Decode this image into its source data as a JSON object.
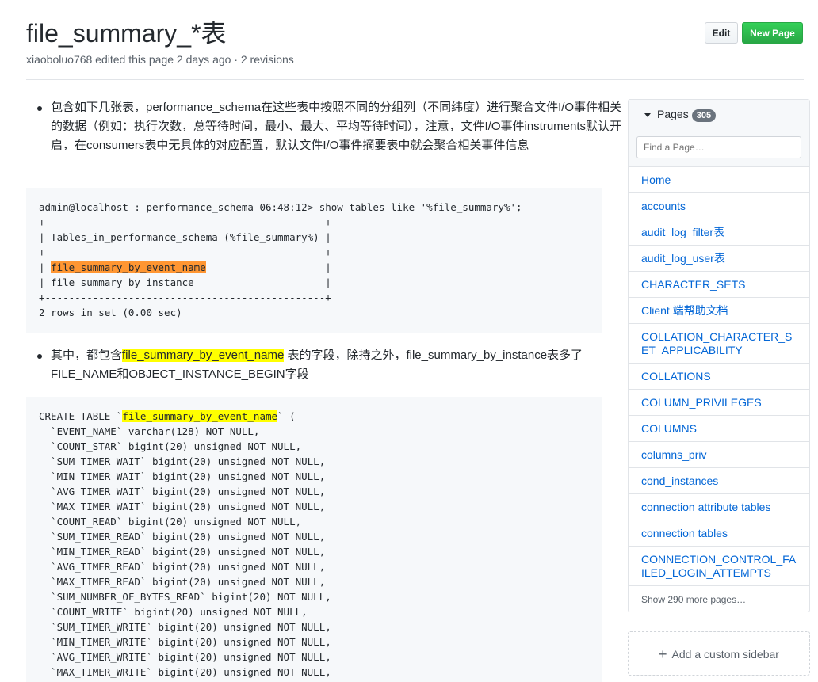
{
  "page": {
    "title": "file_summary_*表",
    "meta": "xiaoboluo768 edited this page 2 days ago · 2 revisions"
  },
  "actions": {
    "edit": "Edit",
    "new_page": "New Page"
  },
  "content": {
    "bullet1": "包含如下几张表，performance_schema在这些表中按照不同的分组列（不同纬度）进行聚合文件I/O事件相关的数据（例如：执行次数，总等待时间，最小、最大、平均等待时间），注意，文件I/O事件instruments默认开启，在consumers表中无具体的对应配置，默认文件I/O事件摘要表中就会聚合相关事件信息",
    "code1": {
      "l1": "admin@localhost : performance_schema 06:48:12> show tables like '%file_summary%';",
      "l2": "+-----------------------------------------------+",
      "l3": "| Tables_in_performance_schema (%file_summary%) |",
      "l4": "+-----------------------------------------------+",
      "l5_pre": "| ",
      "l5_hl": "file_summary_by_event_name",
      "l5_post": "                    |",
      "l6": "| file_summary_by_instance                      |",
      "l7": "+-----------------------------------------------+",
      "l8": "2 rows in set (0.00 sec)"
    },
    "bullet2": {
      "pre": "其中，都包含",
      "hl": "file_summary_by_event_name",
      "post": " 表的字段，除持之外，file_summary_by_instance表多了FILE_NAME和OBJECT_INSTANCE_BEGIN字段"
    },
    "code2": {
      "first_pre": "CREATE TABLE `",
      "first_hl": "file_summary_by_event_name",
      "first_post": "` (",
      "lines": [
        "  `EVENT_NAME` varchar(128) NOT NULL,",
        "  `COUNT_STAR` bigint(20) unsigned NOT NULL,",
        "  `SUM_TIMER_WAIT` bigint(20) unsigned NOT NULL,",
        "  `MIN_TIMER_WAIT` bigint(20) unsigned NOT NULL,",
        "  `AVG_TIMER_WAIT` bigint(20) unsigned NOT NULL,",
        "  `MAX_TIMER_WAIT` bigint(20) unsigned NOT NULL,",
        "  `COUNT_READ` bigint(20) unsigned NOT NULL,",
        "  `SUM_TIMER_READ` bigint(20) unsigned NOT NULL,",
        "  `MIN_TIMER_READ` bigint(20) unsigned NOT NULL,",
        "  `AVG_TIMER_READ` bigint(20) unsigned NOT NULL,",
        "  `MAX_TIMER_READ` bigint(20) unsigned NOT NULL,",
        "  `SUM_NUMBER_OF_BYTES_READ` bigint(20) NOT NULL,",
        "  `COUNT_WRITE` bigint(20) unsigned NOT NULL,",
        "  `SUM_TIMER_WRITE` bigint(20) unsigned NOT NULL,",
        "  `MIN_TIMER_WRITE` bigint(20) unsigned NOT NULL,",
        "  `AVG_TIMER_WRITE` bigint(20) unsigned NOT NULL,",
        "  `MAX_TIMER_WRITE` bigint(20) unsigned NOT NULL,"
      ]
    }
  },
  "sidebar": {
    "title": "Pages",
    "count": "305",
    "search_placeholder": "Find a Page…",
    "items": [
      "Home",
      "accounts",
      "audit_log_filter表",
      "audit_log_user表",
      "CHARACTER_SETS",
      "Client 端帮助文档",
      "COLLATION_CHARACTER_SET_APPLICABILITY",
      "COLLATIONS",
      "COLUMN_PRIVILEGES",
      "COLUMNS",
      "columns_priv",
      "cond_instances",
      "connection attribute tables",
      "connection tables",
      "CONNECTION_CONTROL_FAILED_LOGIN_ATTEMPTS"
    ],
    "more": "Show 290 more pages…",
    "custom": "Add a custom sidebar"
  },
  "colors": {
    "link": "#0366d6",
    "primary_button": "#28a745",
    "highlight_orange": "#ff9632",
    "highlight_yellow": "#ffff00"
  },
  "icons": {
    "caret": "caret-down-icon",
    "plus": "plus-icon"
  }
}
